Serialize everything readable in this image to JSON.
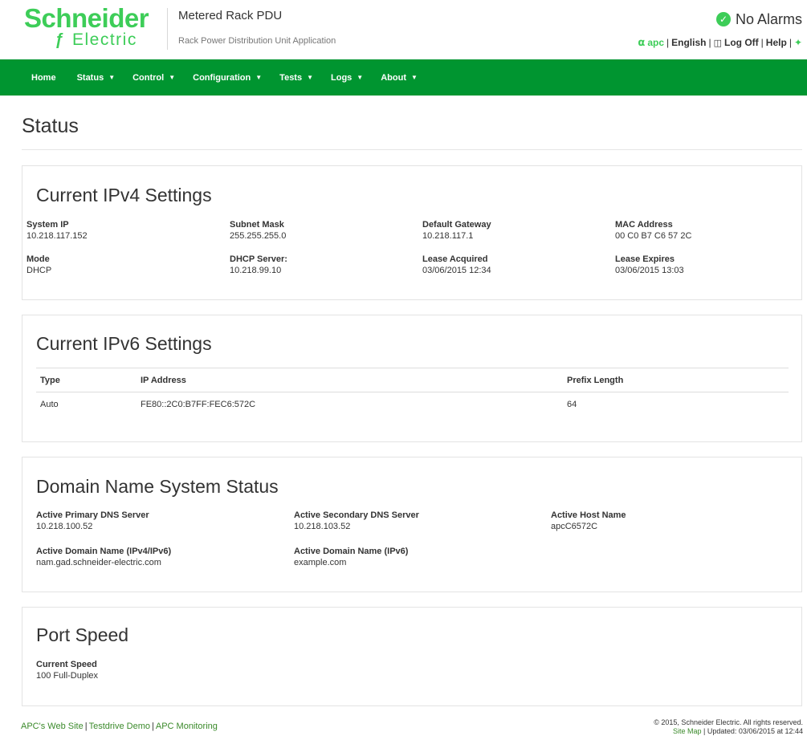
{
  "brand": {
    "logo_main": "Schneider",
    "logo_sub": "Electric",
    "product_title": "Metered Rack PDU",
    "product_subtitle": "Rack Power Distribution Unit Application",
    "accent_color": "#3dcd58",
    "nav_color": "#009530"
  },
  "alarm": {
    "icon": "check-circle-icon",
    "text": "No Alarms"
  },
  "util": {
    "user": "apc",
    "language": "English",
    "logoff": "Log Off",
    "help": "Help"
  },
  "nav": [
    {
      "label": "Home",
      "dropdown": false
    },
    {
      "label": "Status",
      "dropdown": true
    },
    {
      "label": "Control",
      "dropdown": true
    },
    {
      "label": "Configuration",
      "dropdown": true
    },
    {
      "label": "Tests",
      "dropdown": true
    },
    {
      "label": "Logs",
      "dropdown": true
    },
    {
      "label": "About",
      "dropdown": true
    }
  ],
  "page_title": "Status",
  "ipv4": {
    "title": "Current IPv4 Settings",
    "fields": [
      {
        "label": "System IP",
        "value": "10.218.117.152"
      },
      {
        "label": "Subnet Mask",
        "value": "255.255.255.0"
      },
      {
        "label": "Default Gateway",
        "value": "10.218.117.1"
      },
      {
        "label": "MAC Address",
        "value": "00 C0 B7 C6 57 2C"
      },
      {
        "label": "Mode",
        "value": "DHCP"
      },
      {
        "label": "DHCP Server:",
        "value": "10.218.99.10"
      },
      {
        "label": "Lease Acquired",
        "value": "03/06/2015 12:34"
      },
      {
        "label": "Lease Expires",
        "value": "03/06/2015 13:03"
      }
    ]
  },
  "ipv6": {
    "title": "Current IPv6 Settings",
    "headers": [
      "Type",
      "IP Address",
      "Prefix Length"
    ],
    "rows": [
      [
        "Auto",
        "FE80::2C0:B7FF:FEC6:572C",
        "64"
      ]
    ]
  },
  "dns": {
    "title": "Domain Name System Status",
    "fields": [
      {
        "label": "Active Primary DNS Server",
        "value": "10.218.100.52"
      },
      {
        "label": "Active Secondary DNS Server",
        "value": "10.218.103.52"
      },
      {
        "label": "Active Host Name",
        "value": "apcC6572C"
      },
      {
        "label": "Active Domain Name (IPv4/IPv6)",
        "value": "nam.gad.schneider-electric.com"
      },
      {
        "label": "Active Domain Name (IPv6)",
        "value": "example.com"
      }
    ]
  },
  "port": {
    "title": "Port Speed",
    "fields": [
      {
        "label": "Current Speed",
        "value": "100 Full-Duplex"
      }
    ]
  },
  "footer": {
    "links": [
      "APC's Web Site",
      "Testdrive Demo",
      "APC Monitoring"
    ],
    "copyright": "© 2015, Schneider Electric. All rights reserved.",
    "site_map": "Site Map",
    "updated": "Updated: 03/06/2015 at 12:44"
  }
}
